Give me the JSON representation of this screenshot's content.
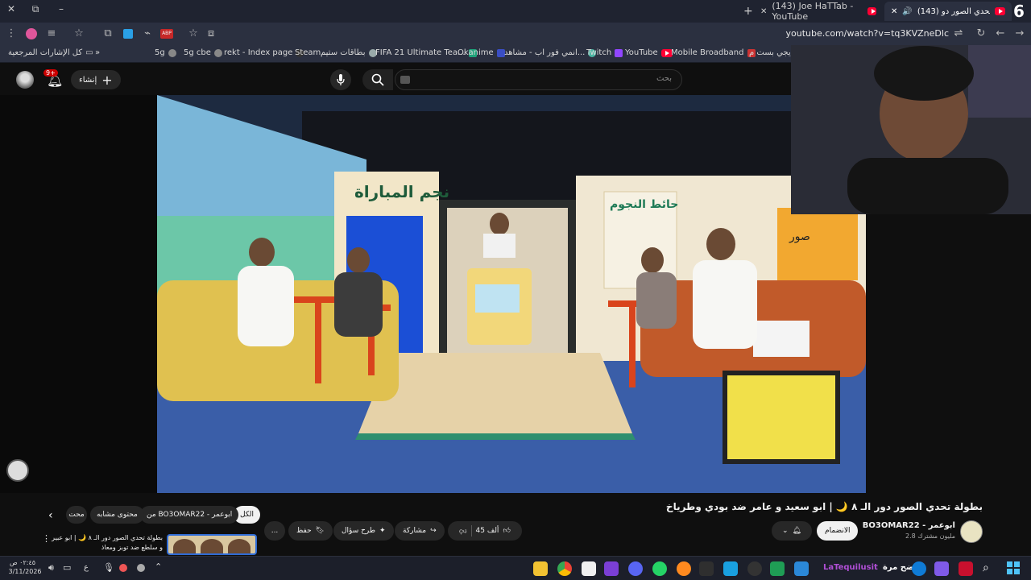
{
  "browser": {
    "tabs": [
      {
        "title": "(143) بطولة تحدي الصور دو...",
        "active": true
      },
      {
        "title": "(143) Joe HaTTab - YouTube",
        "active": false
      }
    ],
    "new_tab_symbol": "+",
    "window_controls": {
      "minimize": "–",
      "restore": "⧉",
      "close": "✕"
    },
    "url": "youtube.com/watch?v=tq3KVZneDlc",
    "corner_badge": "6"
  },
  "bookmarks": {
    "all_bookmarks": "كل الإشارات المرجعية",
    "overflow": "»",
    "items": [
      "5g",
      "5g cbe",
      "rekt - Index page",
      "Steam...",
      "بطاقات ستيم",
      "FIFA 21 Ultimate Tea...",
      "Okanime",
      "انمي فور اب - مشاهد...",
      "Twitch",
      "YouTube",
      "Mobile Broadband",
      "ايجي بست م..."
    ]
  },
  "youtube": {
    "search_placeholder": "بحث",
    "create_label": "إنشاء",
    "notification_count": "9+",
    "video": {
      "title": "بطولة تحدي الصور دور الـ ٨ 🌙 | ابو سعيد و عامر ضد بودي وطرياخ",
      "channel": "BO3OMAR22 - ابوعمر",
      "subscribers": "2.8 مليون مشترك",
      "join_label": "الانضمام",
      "likes": "45 ألف",
      "share_label": "مشاركة",
      "ask_label": "طرح سؤال",
      "save_label": "حفظ",
      "more_label": "...",
      "set_title_left": "نجم المباراة",
      "set_title_right": "حائط النجوم",
      "stage_sign": "صور"
    },
    "filter_chips": [
      "الكل",
      "من BO3OMAR22 - ابوعمر",
      "محتوى مشابه",
      "محت"
    ],
    "up_next": {
      "title": "بطولة تحدي الصور دور الـ ٨ 🌙 | ابو عبير و سلطع ضد توبز ومعاذ",
      "duration": ""
    }
  },
  "taskbar": {
    "time": "٠٢:٤٥ ص",
    "date": "3/11/2026",
    "language": "ع",
    "start_text": "واضح مرة",
    "watermark": "LaTequilusit"
  },
  "colors": {
    "yt_red": "#ff0033",
    "background": "#0f0f0f",
    "chip_bg": "#272727"
  }
}
